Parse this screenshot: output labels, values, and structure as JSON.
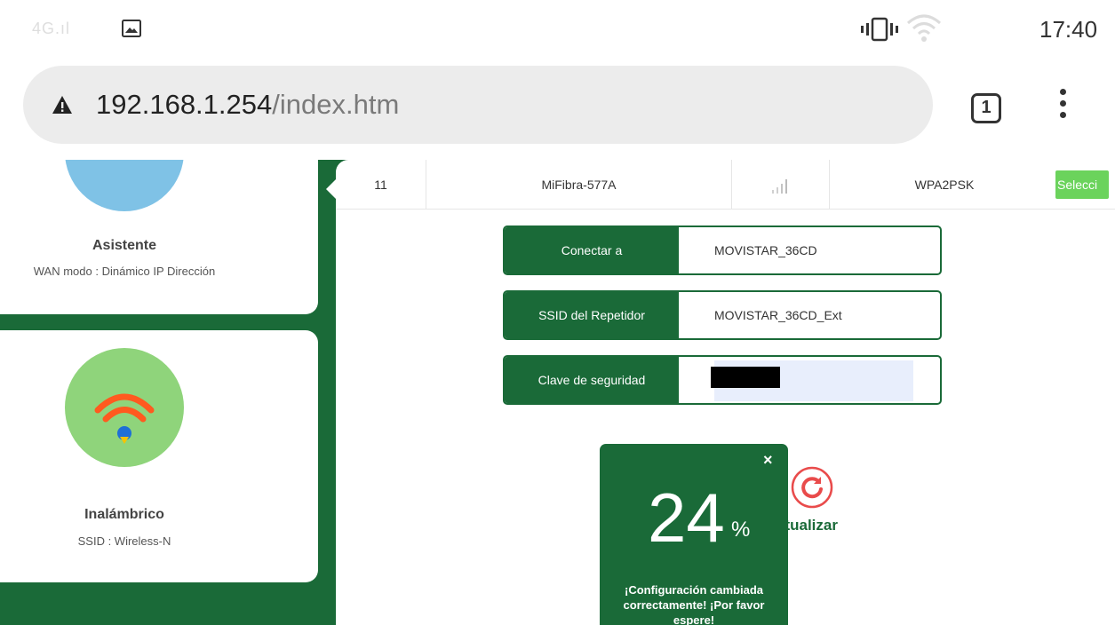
{
  "status_bar": {
    "signal_text": "4G.ıl",
    "time": "17:40",
    "icons": [
      "image-icon",
      "vibrate-icon",
      "wifi-icon"
    ]
  },
  "browser": {
    "url_host": "192.168.1.254",
    "url_path": "/index.htm",
    "tab_count": "1",
    "icons": [
      "warning-icon",
      "tab-switcher-icon",
      "more-vert-icon"
    ]
  },
  "sidebar": {
    "cards": [
      {
        "title": "Asistente",
        "subtitle": "WAN modo : Dinámico IP Dirección",
        "icon": "wizard-globe-icon"
      },
      {
        "title": "Inalámbrico",
        "subtitle": "SSID : Wireless-N",
        "icon": "wifi-icon"
      }
    ]
  },
  "network_row": {
    "channel": "11",
    "ssid": "MiFibra-577A",
    "signal_icon": "signal-bars-icon",
    "security": "WPA2PSK",
    "select_label": "Selecci"
  },
  "form": {
    "connect_to_label": "Conectar a",
    "connect_to_value": "MOVISTAR_36CD",
    "repeater_ssid_label": "SSID del Repetidor",
    "repeater_ssid_value": "MOVISTAR_36CD_Ext",
    "security_key_label": "Clave de seguridad",
    "refresh_label": "ctualizar"
  },
  "progress_popup": {
    "percent": "24",
    "percent_sign": "%",
    "close": "×",
    "message": "¡Configuración cambiada correctamente! ¡Por favor espere!"
  },
  "colors": {
    "brand_green": "#1a6a38",
    "select_green": "#6bd35c",
    "refresh_red": "#e94b4b"
  }
}
